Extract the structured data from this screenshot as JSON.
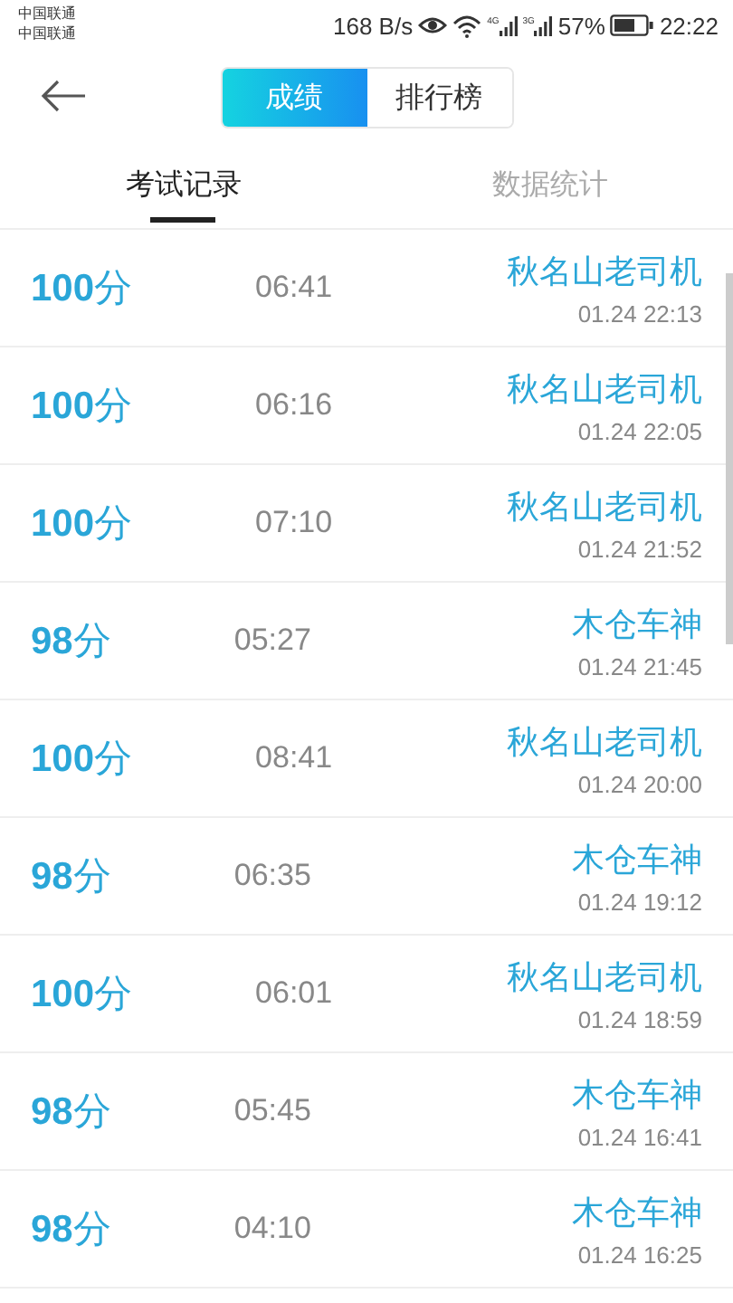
{
  "status_bar": {
    "carriers": [
      "中国联通",
      "中国联通"
    ],
    "speed": "168 B/s",
    "network_1": "4G",
    "network_2": "3G",
    "battery": "57%",
    "time": "22:22"
  },
  "segments": [
    {
      "label": "成绩",
      "selected": true
    },
    {
      "label": "排行榜",
      "selected": false
    }
  ],
  "tabs": [
    {
      "label": "考试记录",
      "selected": true
    },
    {
      "label": "数据统计",
      "selected": false
    }
  ],
  "records": [
    {
      "score": "**100**分",
      "duration": "06:41",
      "name": "秋名山老司机",
      "date": "01.24  22:13"
    },
    {
      "score": "**100**分",
      "duration": "06:16",
      "name": "秋名山老司机",
      "date": "01.24  22:05"
    },
    {
      "score": "**100**分",
      "duration": "07:10",
      "name": "秋名山老司机",
      "date": "01.24  21:52"
    },
    {
      "score": "**98**分",
      "duration": "05:27",
      "name": "木仓车神",
      "date": "01.24  21:45"
    },
    {
      "score": "**100**分",
      "duration": "08:41",
      "name": "秋名山老司机",
      "date": "01.24  20:00"
    },
    {
      "score": "**98**分",
      "duration": "06:35",
      "name": "木仓车神",
      "date": "01.24  19:12"
    },
    {
      "score": "**100**分",
      "duration": "06:01",
      "name": "秋名山老司机",
      "date": "01.24  18:59"
    },
    {
      "score": "**98**分",
      "duration": "05:45",
      "name": "木仓车神",
      "date": "01.24  16:41"
    },
    {
      "score": "**98**分",
      "duration": "04:10",
      "name": "木仓车神",
      "date": "01.24  16:25"
    }
  ]
}
